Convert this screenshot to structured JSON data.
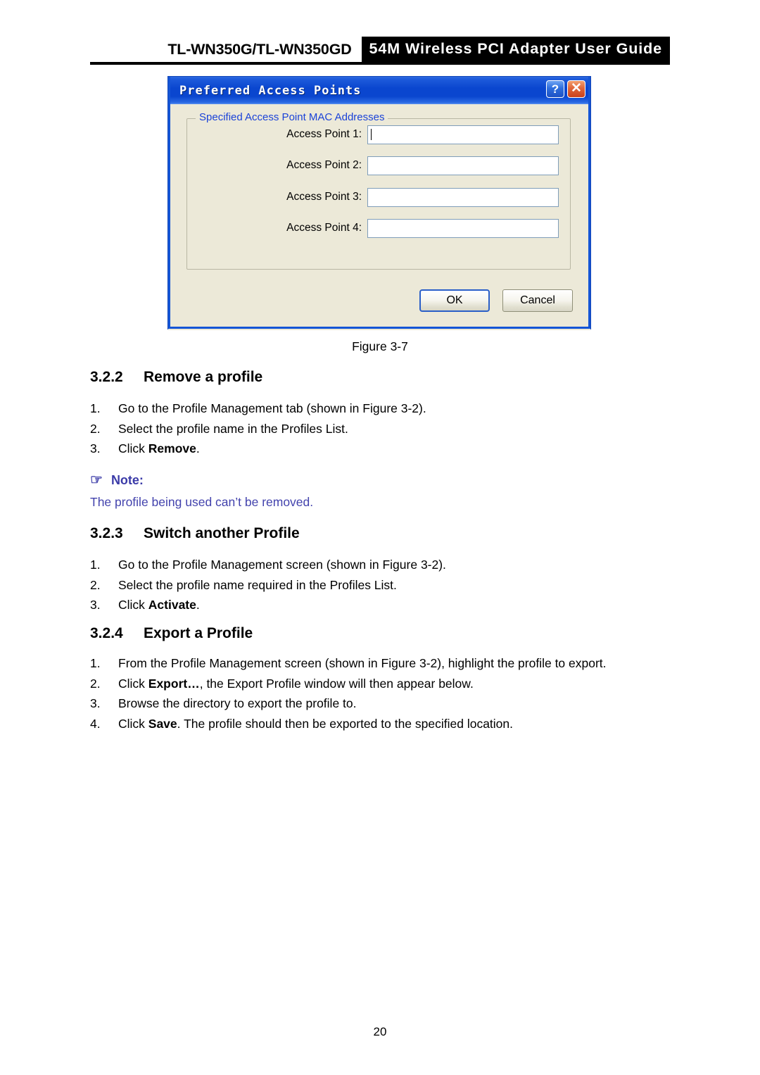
{
  "header": {
    "model": "TL-WN350G/TL-WN350GD",
    "band_title": "54M Wireless PCI Adapter User Guide"
  },
  "dialog": {
    "title": "Preferred Access Points",
    "help_button": "?",
    "close_button": "✕",
    "groupbox_title": "Specified Access Point MAC Addresses",
    "fields": [
      {
        "label": "Access Point 1:",
        "value": ""
      },
      {
        "label": "Access Point 2:",
        "value": ""
      },
      {
        "label": "Access Point 3:",
        "value": ""
      },
      {
        "label": "Access Point 4:",
        "value": ""
      }
    ],
    "ok_label": "OK",
    "cancel_label": "Cancel",
    "colors": {
      "titlebar_blue": "#0a46cf",
      "body_beige": "#ECE9D8",
      "groupbox_label_blue": "#1a42d8",
      "close_orange": "#e0663a"
    }
  },
  "figure_caption": "Figure 3-7",
  "sections": [
    {
      "number": "3.2.2",
      "title": "Remove a profile",
      "steps": [
        {
          "num": "1.",
          "parts": [
            {
              "t": "Go to the Profile Management tab (shown in Figure 3-2).",
              "b": false
            }
          ]
        },
        {
          "num": "2.",
          "parts": [
            {
              "t": "Select the profile name in the Profiles List.",
              "b": false
            }
          ]
        },
        {
          "num": "3.",
          "parts": [
            {
              "t": "Click ",
              "b": false
            },
            {
              "t": "Remove",
              "b": true
            },
            {
              "t": ".",
              "b": false
            }
          ]
        }
      ]
    },
    {
      "number": "3.2.3",
      "title": "Switch another Profile",
      "steps": [
        {
          "num": "1.",
          "parts": [
            {
              "t": "Go to the Profile Management screen (shown in Figure 3-2).",
              "b": false
            }
          ]
        },
        {
          "num": "2.",
          "parts": [
            {
              "t": "Select the profile name required in the Profiles List.",
              "b": false
            }
          ]
        },
        {
          "num": "3.",
          "parts": [
            {
              "t": "Click ",
              "b": false
            },
            {
              "t": "Activate",
              "b": true
            },
            {
              "t": ".",
              "b": false
            }
          ]
        }
      ]
    },
    {
      "number": "3.2.4",
      "title": "Export a Profile",
      "steps": [
        {
          "num": "1.",
          "parts": [
            {
              "t": "From the Profile Management screen (shown in Figure 3-2), highlight the profile to export.",
              "b": false
            }
          ]
        },
        {
          "num": "2.",
          "parts": [
            {
              "t": "Click ",
              "b": false
            },
            {
              "t": "Export…",
              "b": true
            },
            {
              "t": ", the Export Profile window will then appear below.",
              "b": false
            }
          ]
        },
        {
          "num": "3.",
          "parts": [
            {
              "t": "Browse the directory to export the profile to.",
              "b": false
            }
          ]
        },
        {
          "num": "4.",
          "parts": [
            {
              "t": "Click ",
              "b": false
            },
            {
              "t": "Save",
              "b": true
            },
            {
              "t": ". The profile should then be exported to the specified location.",
              "b": false
            }
          ]
        }
      ]
    }
  ],
  "note": {
    "icon": "☞",
    "label": "Note:",
    "text": "The profile being used can’t be removed."
  },
  "page_number": "20"
}
